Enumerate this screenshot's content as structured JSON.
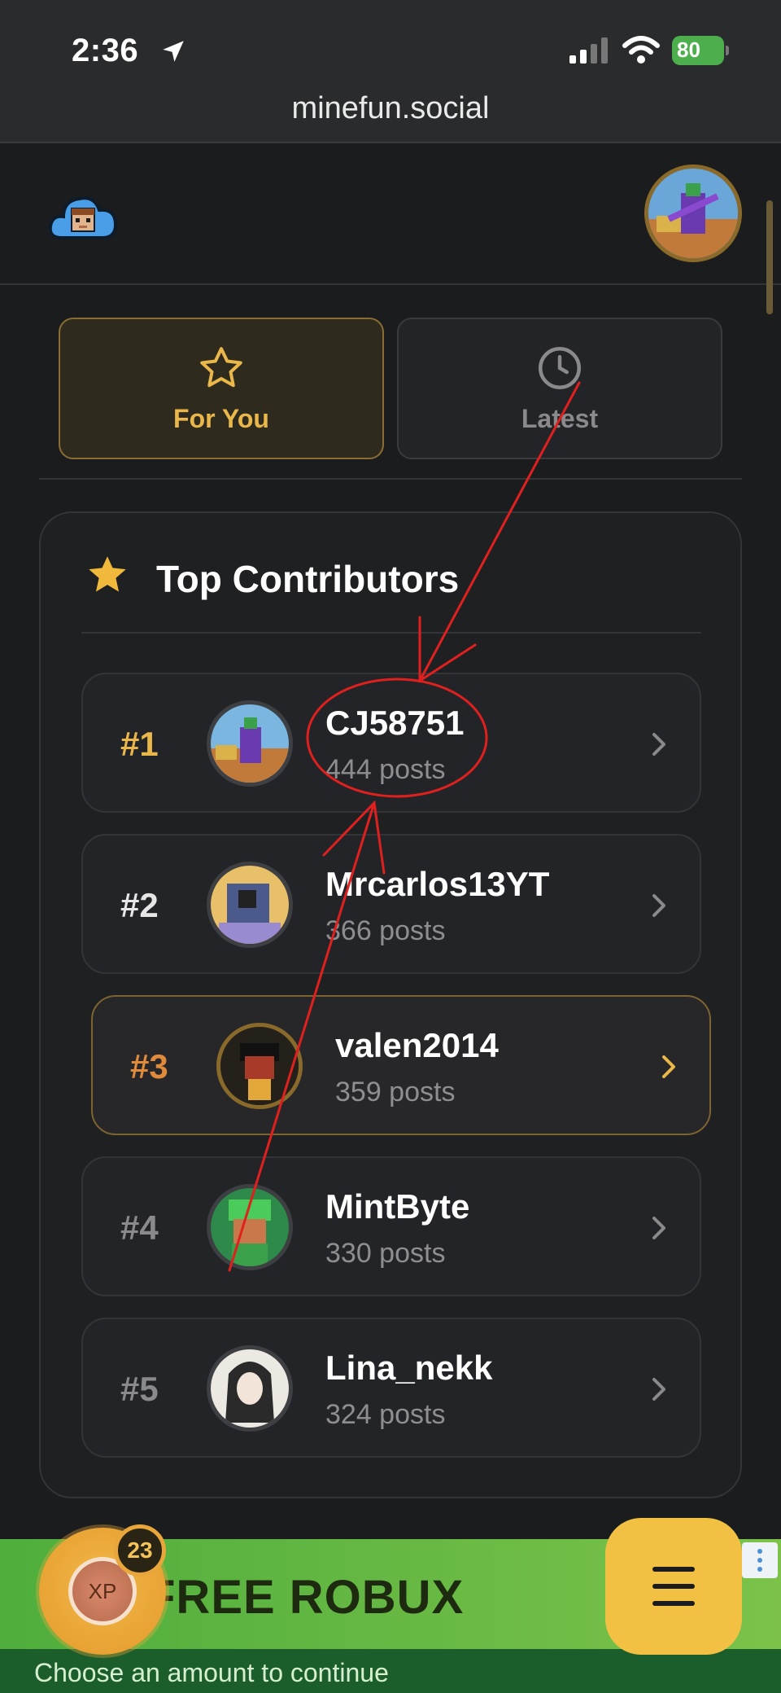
{
  "status_bar": {
    "time": "2:36",
    "battery_level": "80"
  },
  "browser": {
    "url": "minefun.social"
  },
  "tabs": [
    {
      "label": "For You",
      "icon": "star-icon",
      "active": true
    },
    {
      "label": "Latest",
      "icon": "clock-icon",
      "active": false
    }
  ],
  "contributors": {
    "title": "Top Contributors",
    "rows": [
      {
        "rank": "#1",
        "username": "CJ58751",
        "posts": "444 posts"
      },
      {
        "rank": "#2",
        "username": "Mrcarlos13YT",
        "posts": "366 posts"
      },
      {
        "rank": "#3",
        "username": "valen2014",
        "posts": "359 posts"
      },
      {
        "rank": "#4",
        "username": "MintByte",
        "posts": "330 posts"
      },
      {
        "rank": "#5",
        "username": "Lina_nekk",
        "posts": "324 posts"
      }
    ]
  },
  "ad": {
    "headline": "FREE ROBUX",
    "subtext": "Choose an amount to continue"
  },
  "xp": {
    "label": "XP",
    "count": "23"
  },
  "colors": {
    "accent": "#e9b74a",
    "rank3": "#e08a3c",
    "annotation": "#e0201e",
    "background": "#1b1c1e"
  }
}
